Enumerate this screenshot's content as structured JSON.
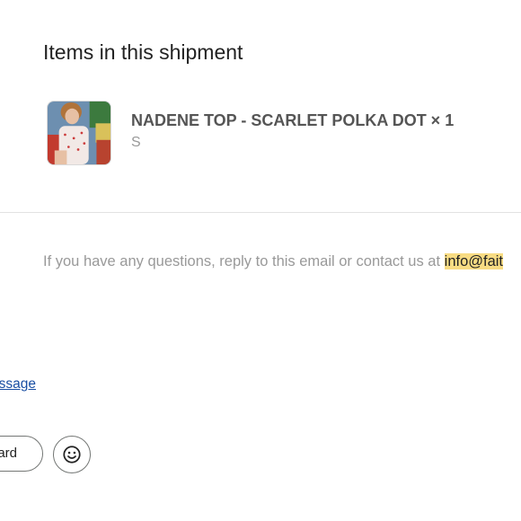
{
  "shipment": {
    "title": "Items in this shipment",
    "items": [
      {
        "name": "NADENE TOP - SCARLET POLKA DOT × 1",
        "variant": "S"
      }
    ]
  },
  "footer": {
    "contact_text": "If you have any questions, reply to this email or contact us at ",
    "contact_email": "info@fait"
  },
  "actions": {
    "message_link": "essage",
    "forward_label": "ard",
    "emoji_icon": "smiley-face-icon"
  },
  "colors": {
    "highlight": "#f8dc83",
    "link": "#1a4fa3",
    "divider": "#e2e2e2"
  }
}
